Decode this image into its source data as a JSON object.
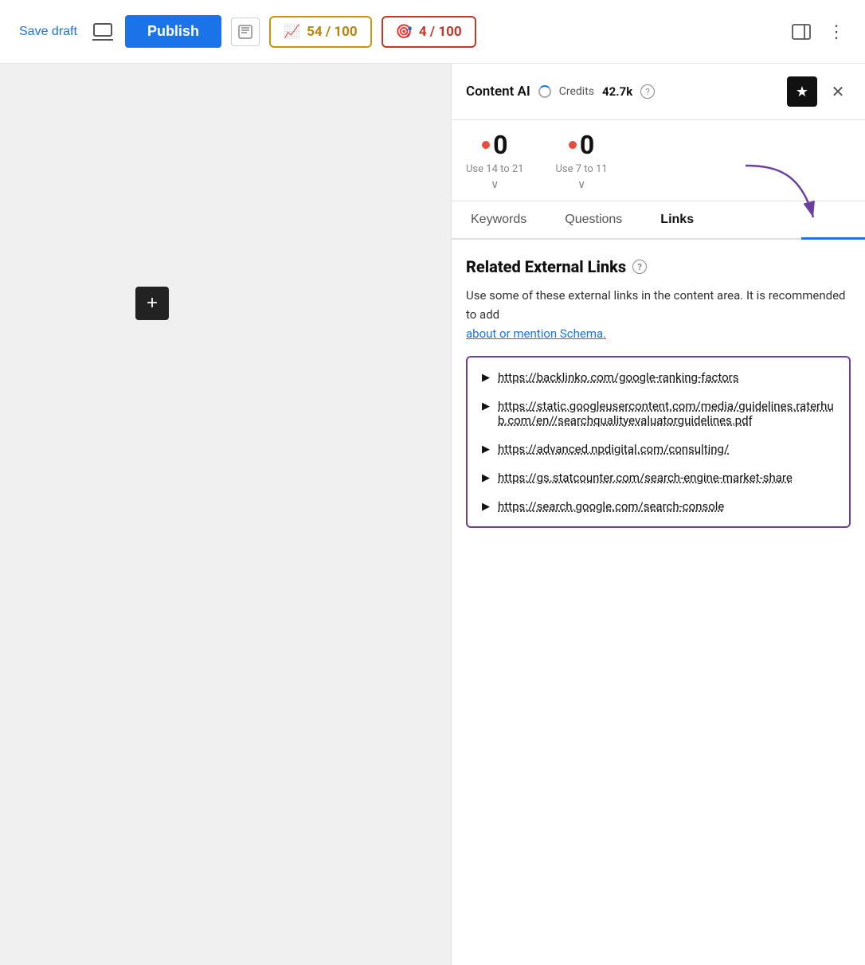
{
  "toolbar": {
    "save_draft_label": "Save draft",
    "publish_label": "Publish",
    "score_yellow": "54 / 100",
    "score_red": "4 / 100"
  },
  "panel": {
    "title": "Content AI",
    "credits_label": "Credits",
    "credits_value": "42.7k",
    "star_icon": "★",
    "close_icon": "✕"
  },
  "scores": [
    {
      "hint": "Use 14 to 21",
      "value": "0"
    },
    {
      "hint": "Use 7 to 11",
      "value": "0"
    }
  ],
  "tabs": [
    {
      "label": "Keywords",
      "active": false
    },
    {
      "label": "Questions",
      "active": false
    },
    {
      "label": "Links",
      "active": true
    }
  ],
  "links_section": {
    "title": "Related External Links",
    "description_main": "Use some of these external links in the content area. It is recommended to add",
    "description_link": "about or mention Schema.",
    "links": [
      {
        "url": "https://backlinko.com/google-ranking-factors"
      },
      {
        "url": "https://static.googleusercontent.com/media/guidelines.raterhub.com/en//searchqualityevaluatorguidelines.pdf"
      },
      {
        "url": "https://advanced.npdigital.com/consulting/"
      },
      {
        "url": "https://gs.statcounter.com/search-engine-market-share"
      },
      {
        "url": "https://search.google.com/search-console"
      }
    ]
  },
  "add_block_label": "+"
}
